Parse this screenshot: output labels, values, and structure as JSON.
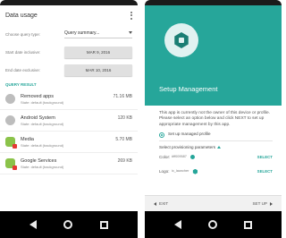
{
  "left": {
    "title": "Data usage",
    "query_type_label": "Choose query type:",
    "query_type_value": "Query summary...",
    "start_date_label": "Start date inclusive:",
    "start_date_value": "MAR 9, 2016",
    "end_date_label": "End date exclusive:",
    "end_date_value": "MAR 10, 2016",
    "result_header": "QUERY RESULT",
    "items": [
      {
        "name": "Removed apps",
        "size": "71.16 MB",
        "state": "State: default (background)"
      },
      {
        "name": "Android System",
        "size": "120 KB",
        "state": "State: default (background)"
      },
      {
        "name": "Media",
        "size": "5.70 MB",
        "state": "State: default (background)"
      },
      {
        "name": "Google Services",
        "size": "269 KB",
        "state": "State: default (background)"
      }
    ]
  },
  "right": {
    "title": "Setup Management",
    "body": "This app is currently not the owner of this device or profile. Please select an option below and click NEXT to set up appropriate management by this app.",
    "radio_label": "Set up managed profile",
    "provision_header": "Select provisioning parameters",
    "color_label": "Color:",
    "color_value": "#ff009587",
    "logo_label": "Logo:",
    "logo_value": "ic_launcher",
    "select_label": "SELECT",
    "exit_label": "EXIT",
    "setup_label": "SET UP"
  },
  "colors": {
    "accent": "#26a69a"
  }
}
